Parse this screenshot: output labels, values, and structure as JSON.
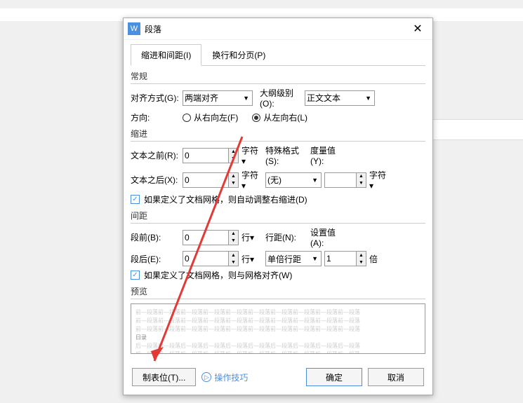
{
  "dialog": {
    "title": "段落",
    "tabs": [
      {
        "label": "缩进和间距(I)",
        "active": true
      },
      {
        "label": "换行和分页(P)",
        "active": false
      }
    ],
    "sections": {
      "general": {
        "title": "常规",
        "alignment": {
          "label": "对齐方式(G):",
          "value": "两端对齐"
        },
        "outline": {
          "label": "大纲级别(O):",
          "value": "正文文本"
        },
        "direction": {
          "label": "方向:",
          "rtl": "从右向左(F)",
          "ltr": "从左向右(L)",
          "selected": "ltr"
        }
      },
      "indent": {
        "title": "缩进",
        "before": {
          "label": "文本之前(R):",
          "value": "0",
          "unit": "字符▾"
        },
        "after": {
          "label": "文本之后(X):",
          "value": "0",
          "unit": "字符▾"
        },
        "special": {
          "label": "特殊格式(S):",
          "value": "(无)"
        },
        "measure": {
          "label": "度量值(Y):",
          "value": "",
          "unit": "字符▾"
        },
        "auto_checkbox": "如果定义了文档网格，则自动调整右缩进(D)"
      },
      "spacing": {
        "title": "间距",
        "before": {
          "label": "段前(B):",
          "value": "0",
          "unit": "行▾"
        },
        "after": {
          "label": "段后(E):",
          "value": "0",
          "unit": "行▾"
        },
        "line_spacing": {
          "label": "行距(N):",
          "value": "单倍行距"
        },
        "at": {
          "label": "设置值(A):",
          "value": "1",
          "unit": "倍"
        },
        "grid_checkbox": "如果定义了文档网格，则与网格对齐(W)"
      },
      "preview": {
        "title": "预览",
        "lines": [
          "前—段落前—段落前—段落前—段落前—段落前—段落前—段落前—段落前—段落前—段落",
          "前—段落前—段落前—段落前—段落前—段落前—段落前—段落前—段落前—段落前—段落",
          "前—段落前—段落前—段落前—段落前—段落前—段落前—段落前—段落前—段落前—段落",
          "日录",
          "后—段落后—段落后—段落后—段落后—段落后—段落后—段落后—段落后—段落后—段落",
          "后—段落后—段落后—段落后—段落后—段落后—段落后—段落后—段落后—段落后—段落"
        ]
      }
    },
    "footer": {
      "tabstops": "制表位(T)...",
      "tips": "操作技巧",
      "ok": "确定",
      "cancel": "取消"
    }
  }
}
